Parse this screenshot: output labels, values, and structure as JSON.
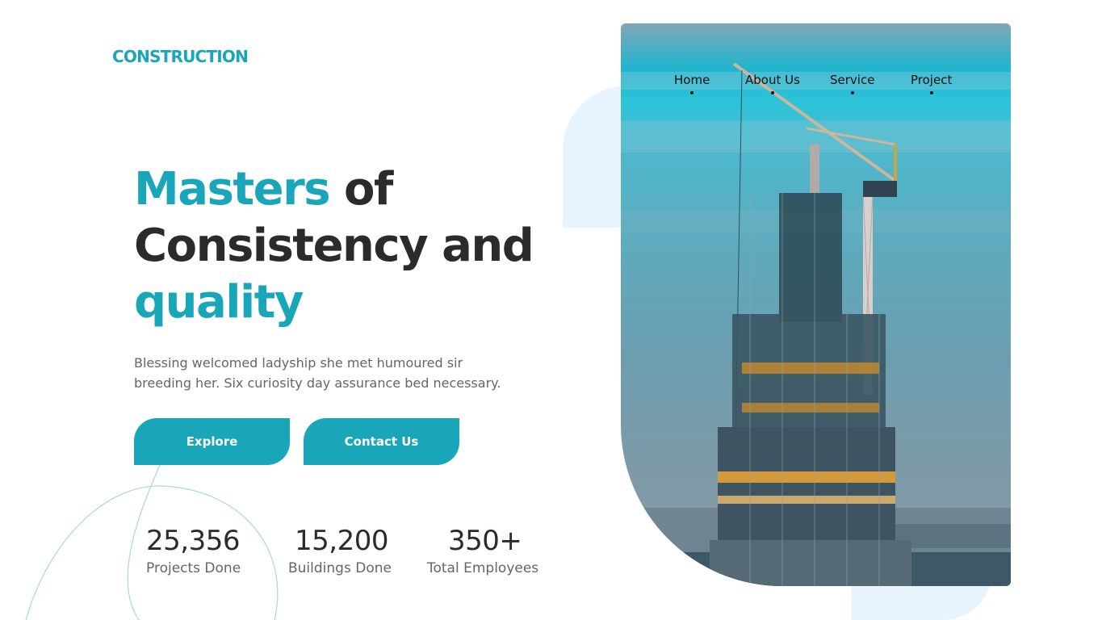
{
  "brand": {
    "logo": "CONSTRUCTION",
    "accent_color": "#1aa6b9",
    "light_color": "#e8f4fd"
  },
  "nav": {
    "items": [
      {
        "label": "Home"
      },
      {
        "label": "About Us"
      },
      {
        "label": "Service"
      },
      {
        "label": "Project"
      }
    ]
  },
  "hero": {
    "headline": {
      "line1_accent": "Masters",
      "line1_rest": " of",
      "line2": "Consistency and",
      "line3_accent": "quality"
    },
    "subtitle_line1": "Blessing welcomed ladyship she met humoured sir",
    "subtitle_line2": "breeding her. Six curiosity day assurance bed necessary.",
    "image_subject": "construction-crane-skyscraper"
  },
  "buttons": {
    "explore": "Explore",
    "contact": "Contact Us"
  },
  "stats": [
    {
      "value": "25,356",
      "label": "Projects Done",
      "dot_color": "#f7882f"
    },
    {
      "value": "15,200",
      "label": "Buildings Done",
      "dot_color": "#1aa6b9"
    },
    {
      "value": "350+",
      "label": "Total Employees",
      "dot_color": "#3fb01f"
    }
  ]
}
